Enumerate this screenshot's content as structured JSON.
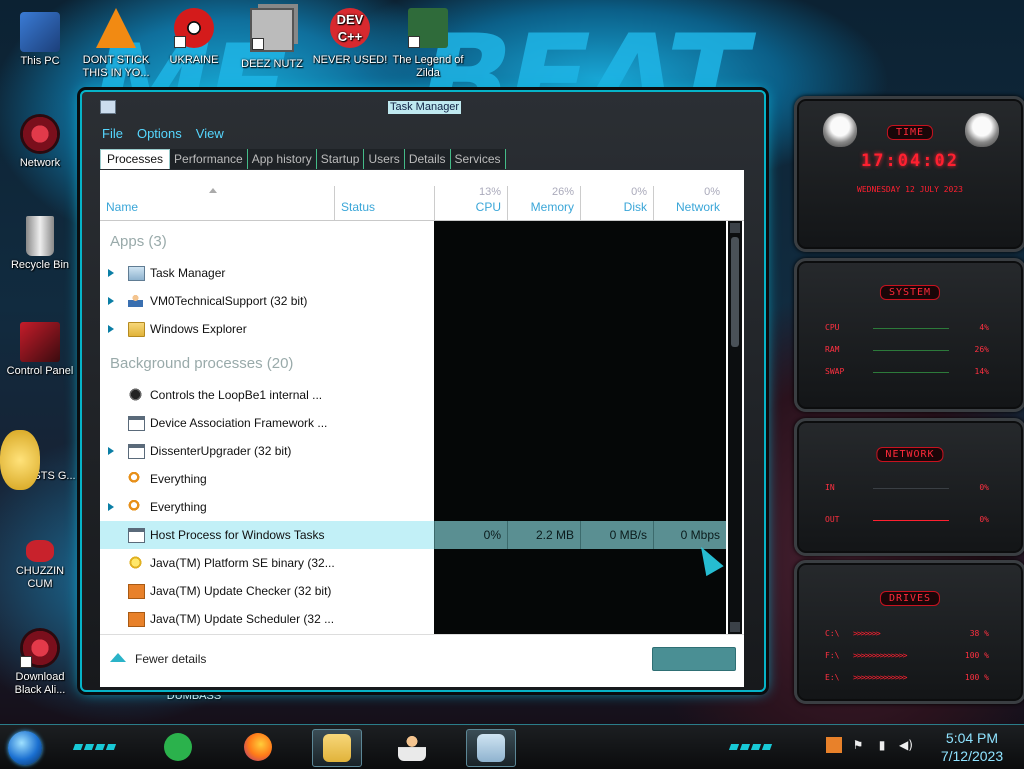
{
  "desktop": {
    "icons": [
      {
        "label": "This PC"
      },
      {
        "label": "DONT STICK THIS IN YO..."
      },
      {
        "label": "UKRAINE"
      },
      {
        "label": "DEEZ NUTZ"
      },
      {
        "label": "NEVER USED!"
      },
      {
        "label": "The Legend of Zilda"
      },
      {
        "label": "Network"
      },
      {
        "label": "Recycle Bin"
      },
      {
        "label": "Control Panel"
      },
      {
        "label": "ISTS G..."
      },
      {
        "label": "CHUZZIN CUM"
      },
      {
        "label": "Download Black Ali..."
      },
      {
        "label": "DUMBASS"
      }
    ],
    "dev_icon_text": "DEV C++"
  },
  "task_manager": {
    "title": "Task Manager",
    "menu": [
      "File",
      "Options",
      "View"
    ],
    "tabs": [
      "Processes",
      "Performance",
      "App history",
      "Startup",
      "Users",
      "Details",
      "Services"
    ],
    "columns": {
      "name": "Name",
      "status": "Status",
      "cpu": {
        "label": "CPU",
        "pct": "13%"
      },
      "memory": {
        "label": "Memory",
        "pct": "26%"
      },
      "disk": {
        "label": "Disk",
        "pct": "0%"
      },
      "network": {
        "label": "Network",
        "pct": "0%"
      }
    },
    "apps_header": "Apps (3)",
    "apps": [
      {
        "name": "Task Manager",
        "icon": "task-manager-icon",
        "expandable": true
      },
      {
        "name": "VM0TechnicalSupport (32 bit)",
        "icon": "person-icon",
        "expandable": true
      },
      {
        "name": "Windows Explorer",
        "icon": "folder-icon",
        "expandable": true
      }
    ],
    "background_header": "Background processes (20)",
    "background": [
      {
        "name": "Controls the LoopBe1 internal ...",
        "icon": "loopbe-icon",
        "expandable": false
      },
      {
        "name": "Device Association Framework ...",
        "icon": "window-icon",
        "expandable": false
      },
      {
        "name": "DissenterUpgrader (32 bit)",
        "icon": "window-icon",
        "expandable": true
      },
      {
        "name": "Everything",
        "icon": "search-icon",
        "expandable": false
      },
      {
        "name": "Everything",
        "icon": "search-icon",
        "expandable": true
      },
      {
        "name": "Host Process for Windows Tasks",
        "icon": "window-icon",
        "expandable": false,
        "selected": true,
        "cpu": "0%",
        "memory": "2.2 MB",
        "disk": "0 MB/s",
        "network": "0 Mbps"
      },
      {
        "name": "Java(TM) Platform SE binary (32...",
        "icon": "java-icon",
        "expandable": false
      },
      {
        "name": "Java(TM) Update Checker (32 bit)",
        "icon": "update-icon",
        "expandable": false
      },
      {
        "name": "Java(TM) Update Scheduler (32 ...",
        "icon": "update-icon",
        "expandable": false
      }
    ],
    "footer": {
      "fewer_details": "Fewer details",
      "end_task": ""
    }
  },
  "gadgets": {
    "time": {
      "title": "Time",
      "clock": "17:04:02",
      "date": "WEDNESDAY 12 JULY 2023"
    },
    "system": {
      "title": "System",
      "rows": [
        {
          "label": "CPU",
          "value": "4%"
        },
        {
          "label": "RAM",
          "value": "26%"
        },
        {
          "label": "SWAP",
          "value": "14%"
        }
      ]
    },
    "network": {
      "title": "Network",
      "rows": [
        {
          "label": "IN",
          "value": "0%"
        },
        {
          "label": "OUT",
          "value": "0%"
        }
      ]
    },
    "drives": {
      "title": "Drives",
      "rows": [
        {
          "label": "C:\\",
          "value": "38 %"
        },
        {
          "label": "F:\\",
          "value": "100 %"
        },
        {
          "label": "E:\\",
          "value": "100 %"
        }
      ]
    },
    "accent_color": "#ff2030"
  },
  "taskbar": {
    "time": "5:04 PM",
    "date": "7/12/2023",
    "pinned": [
      "start-icon",
      "feedly-icon",
      "firefox-icon",
      "file-explorer-icon",
      "support-icon",
      "task-manager-icon"
    ],
    "accent_color": "#18c9d6"
  }
}
